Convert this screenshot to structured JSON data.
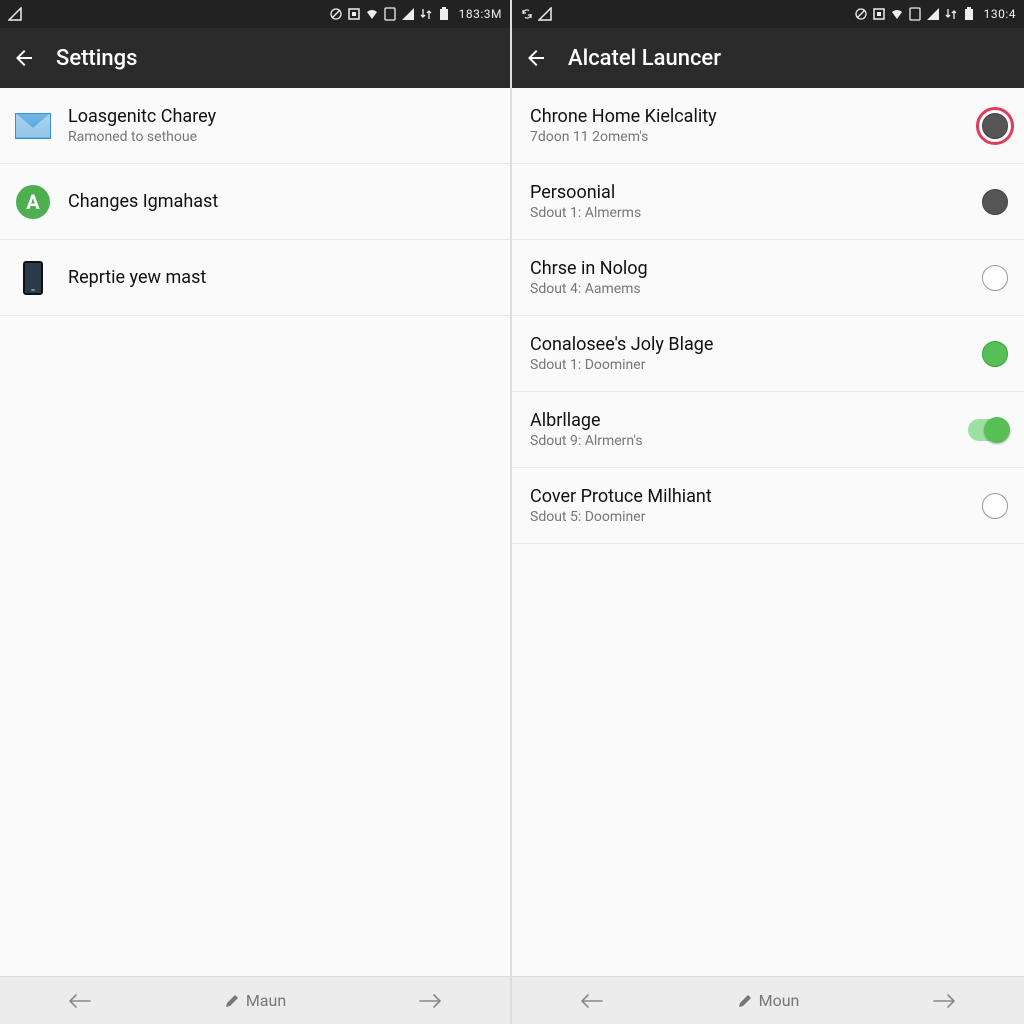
{
  "left": {
    "status": {
      "time": "183:3M"
    },
    "app_bar": {
      "title": "Settings"
    },
    "items": [
      {
        "title": "Loasgenitc Charey",
        "sub": "Ramoned to sethoue"
      },
      {
        "title": "Changes Igmahast",
        "sub": ""
      },
      {
        "title": "Reprtie yew mast",
        "sub": ""
      }
    ],
    "nav": {
      "center_label": "Maun"
    }
  },
  "right": {
    "status": {
      "time": "130:4"
    },
    "app_bar": {
      "title": "Alcatel Launcer"
    },
    "items": [
      {
        "title": "Chrone Home Kielcality",
        "sub": "7doon 11 2omem's",
        "control": "radio-dark-highlight"
      },
      {
        "title": "Persoonial",
        "sub": "Sdout 1: Almerms",
        "control": "radio-dark"
      },
      {
        "title": "Chrse in Nolog",
        "sub": "Sdout 4: Aamems",
        "control": "radio"
      },
      {
        "title": "Conalosee's Joly Blage",
        "sub": "Sdout 1: Doominer",
        "control": "radio-green"
      },
      {
        "title": "Albrllage",
        "sub": "Sdout 9: Alrmern's",
        "control": "toggle-on"
      },
      {
        "title": "Cover Protuce Milhiant",
        "sub": "Sdout 5: Doominer",
        "control": "radio"
      }
    ],
    "nav": {
      "center_label": "Moun"
    }
  }
}
